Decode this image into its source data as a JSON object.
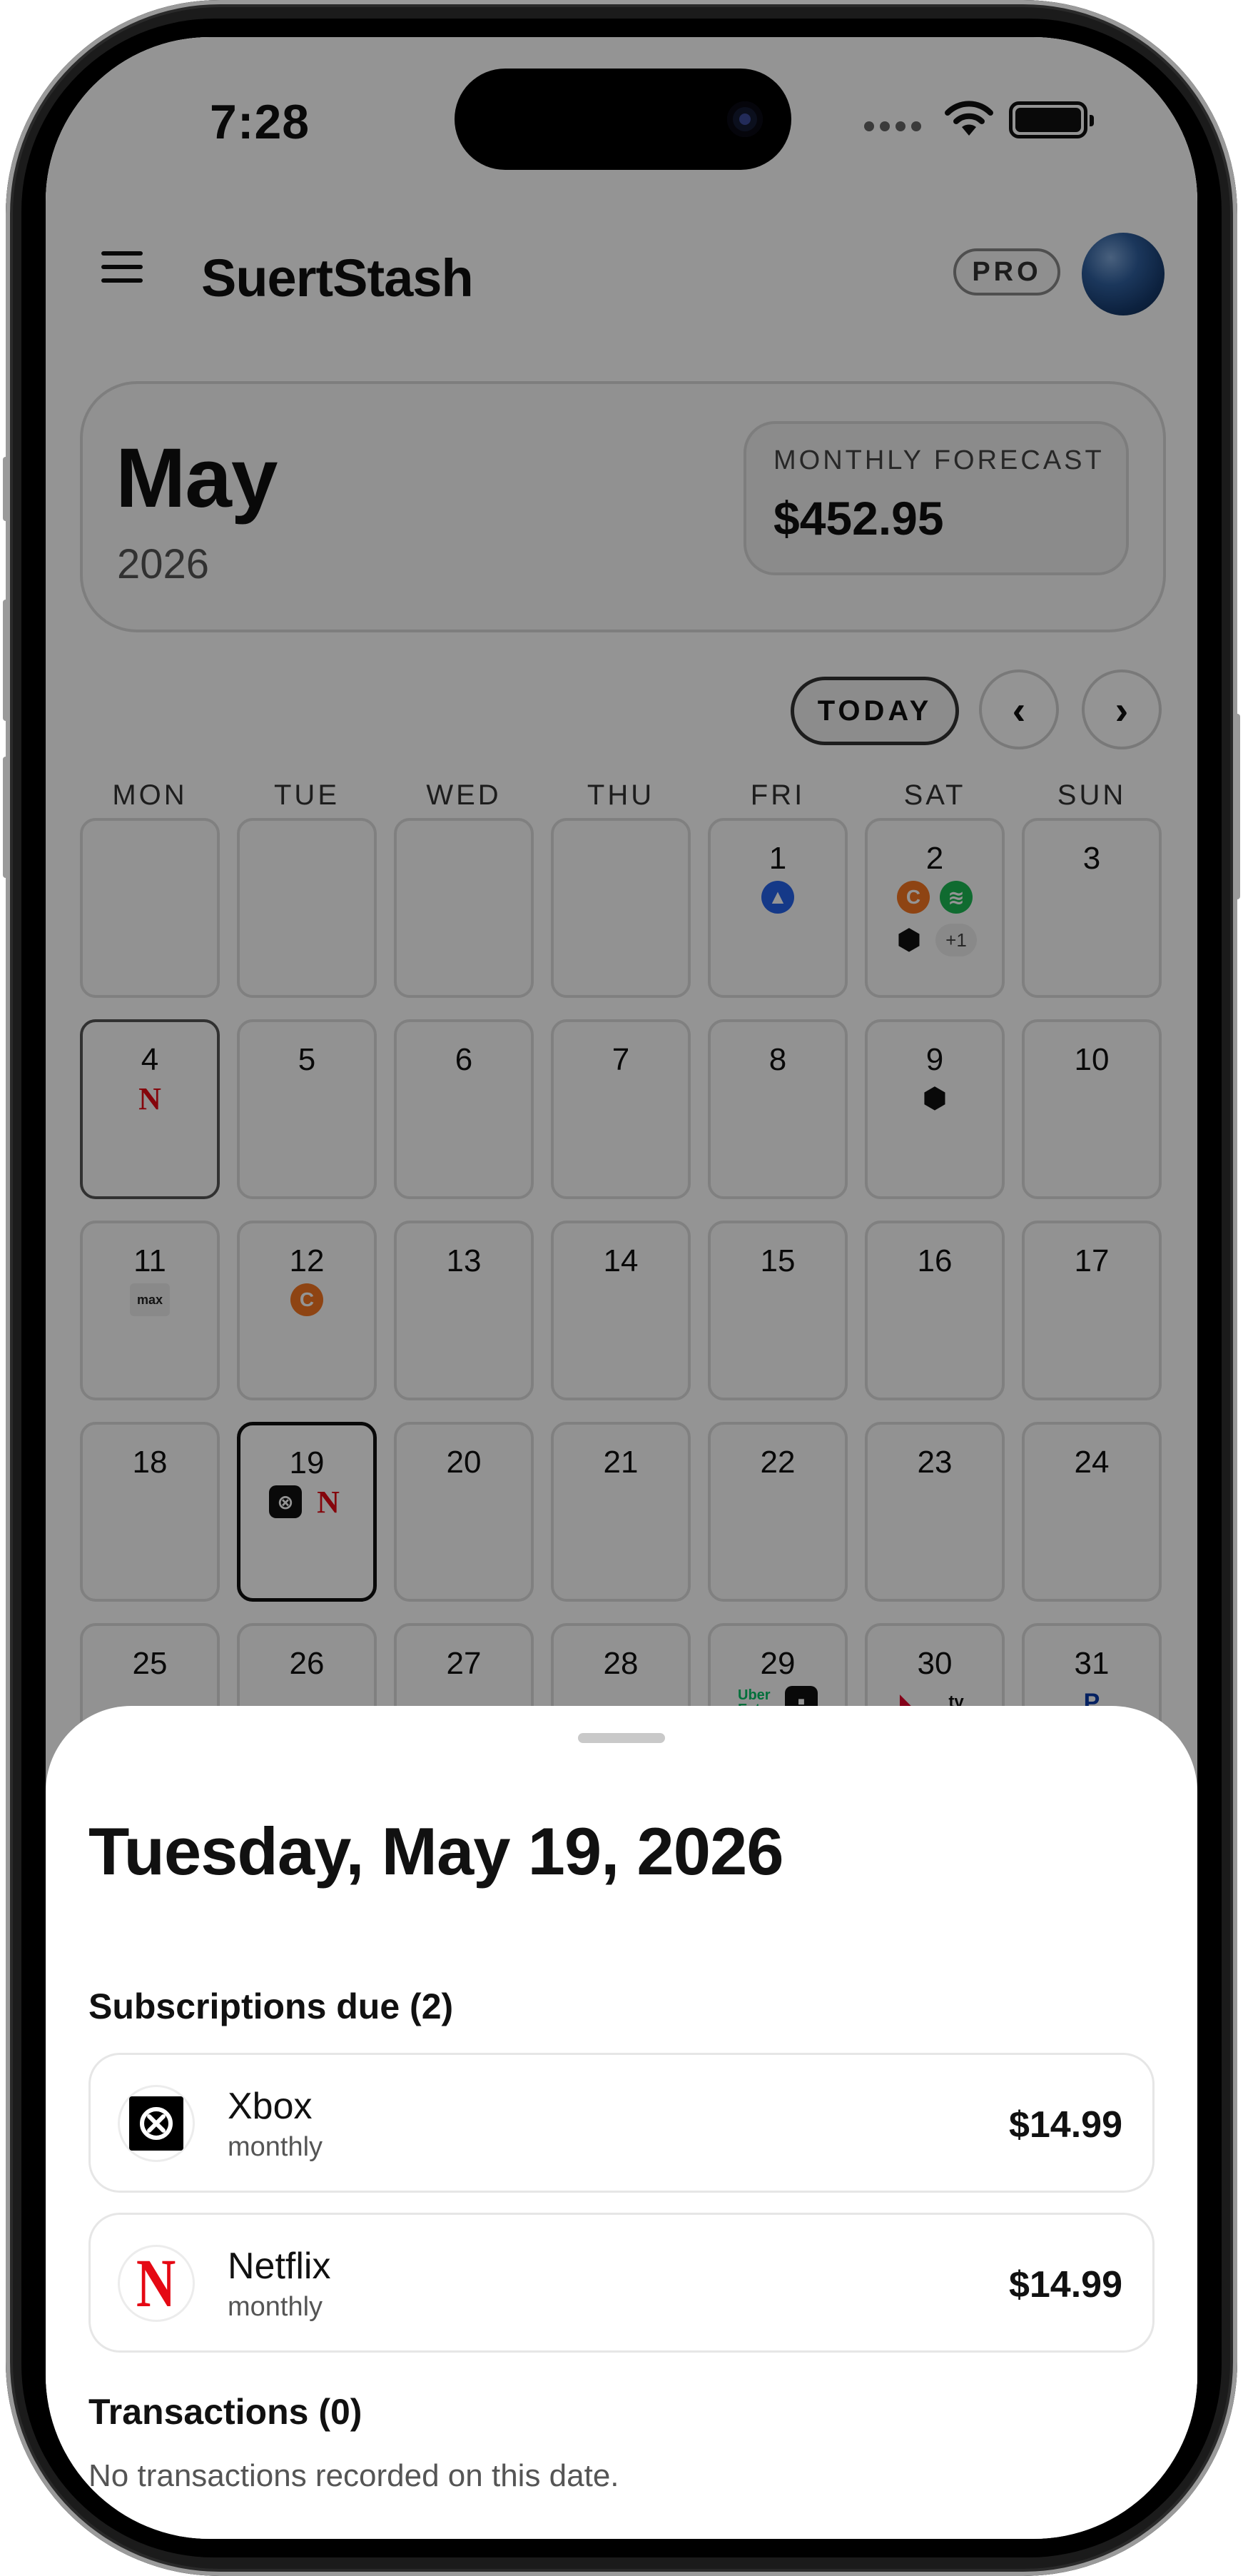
{
  "status_bar": {
    "time": "7:28"
  },
  "header": {
    "app_title": "SuertStash",
    "pro_badge": "PRO"
  },
  "month_card": {
    "month": "May",
    "year": "2026",
    "forecast_label": "MONTHLY FORECAST",
    "forecast_value": "$452.95"
  },
  "calendar_nav": {
    "today_label": "TODAY",
    "prev_icon": "chevron-left-icon",
    "next_icon": "chevron-right-icon"
  },
  "weekdays": [
    "MON",
    "TUE",
    "WED",
    "THU",
    "FRI",
    "SAT",
    "SUN"
  ],
  "calendar_weeks": [
    [
      {
        "day": ""
      },
      {
        "day": ""
      },
      {
        "day": ""
      },
      {
        "day": ""
      },
      {
        "day": "1",
        "icons": [
          "paramount"
        ]
      },
      {
        "day": "2",
        "icons": [
          "crunchyroll",
          "spotify",
          "box",
          "more"
        ],
        "more": "+1"
      },
      {
        "day": "3"
      }
    ],
    [
      {
        "day": "4",
        "icons": [
          "netflix"
        ],
        "today": true
      },
      {
        "day": "5"
      },
      {
        "day": "6"
      },
      {
        "day": "7"
      },
      {
        "day": "8"
      },
      {
        "day": "9",
        "icons": [
          "box"
        ]
      },
      {
        "day": "10"
      }
    ],
    [
      {
        "day": "11",
        "icons": [
          "max"
        ]
      },
      {
        "day": "12",
        "icons": [
          "crunchyroll"
        ]
      },
      {
        "day": "13"
      },
      {
        "day": "14"
      },
      {
        "day": "15"
      },
      {
        "day": "16"
      },
      {
        "day": "17"
      }
    ],
    [
      {
        "day": "18"
      },
      {
        "day": "19",
        "icons": [
          "xbox",
          "netflix"
        ],
        "selected": true
      },
      {
        "day": "20"
      },
      {
        "day": "21"
      },
      {
        "day": "22"
      },
      {
        "day": "23"
      },
      {
        "day": "24"
      }
    ],
    [
      {
        "day": "25"
      },
      {
        "day": "26"
      },
      {
        "day": "27"
      },
      {
        "day": "28"
      },
      {
        "day": "29",
        "icons": [
          "uber-eats",
          "dark-app"
        ]
      },
      {
        "day": "30",
        "icons": [
          "red-app",
          "apple-tv"
        ]
      },
      {
        "day": "31",
        "icons": [
          "playstation"
        ]
      }
    ]
  ],
  "icon_glyphs": {
    "paramount": "▲",
    "crunchyroll": "C",
    "spotify": "≋",
    "box": "⬢",
    "netflix": "N",
    "xbox": "⊗",
    "max": "max",
    "uber-eats": "Uber Eats",
    "dark-app": "■",
    "red-app": "◣",
    "apple-tv": "tv",
    "playstation": "P"
  },
  "colors": {
    "netflix": "#e50914",
    "spotify": "#1db954",
    "crunchyroll": "#f47521",
    "paramount": "#2563eb"
  },
  "sheet": {
    "title": "Tuesday, May 19, 2026",
    "subscriptions_heading": "Subscriptions due (2)",
    "subscriptions": [
      {
        "name": "Xbox",
        "cycle": "monthly",
        "price": "$14.99",
        "logo": "xbox-icon"
      },
      {
        "name": "Netflix",
        "cycle": "monthly",
        "price": "$14.99",
        "logo": "netflix-icon"
      }
    ],
    "transactions_heading": "Transactions (0)",
    "transactions_empty": "No transactions recorded on this date."
  }
}
